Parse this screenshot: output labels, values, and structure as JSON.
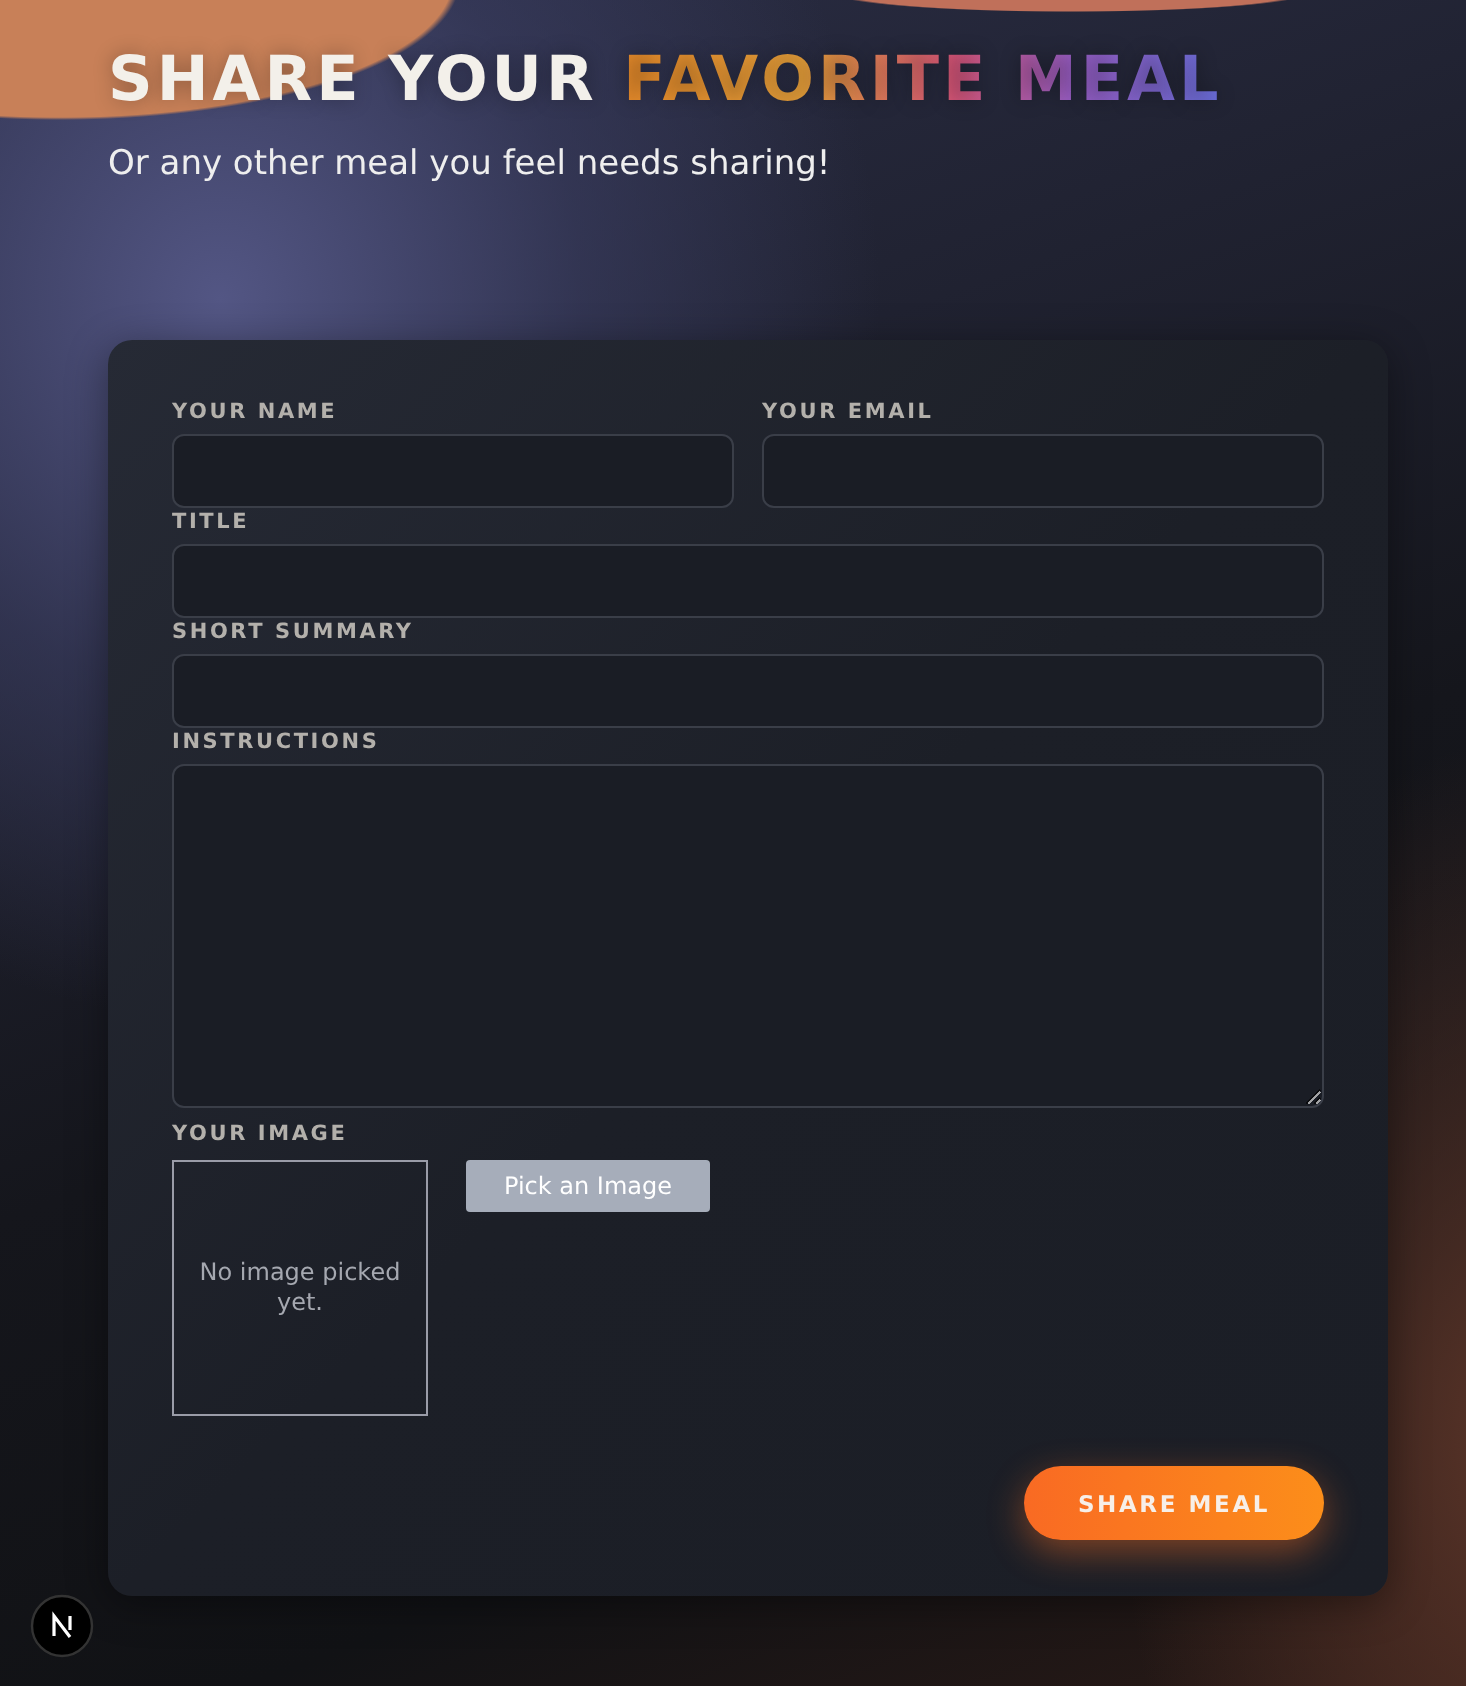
{
  "header": {
    "title": "SHARE YOUR",
    "title_highlight": "FAVORITE MEAL",
    "subtitle": "Or any other meal you feel needs sharing!"
  },
  "form": {
    "rows": [
      [
        {
          "label": "YOUR NAME",
          "kind": "input"
        },
        {
          "label": "YOUR EMAIL",
          "kind": "input"
        }
      ],
      [
        {
          "label": "TITLE",
          "kind": "input"
        }
      ],
      [
        {
          "label": "SHORT SUMMARY",
          "kind": "input"
        }
      ],
      [
        {
          "label": "INSTRUCTIONS",
          "kind": "textarea"
        }
      ]
    ],
    "image_picker": {
      "label": "YOUR IMAGE",
      "preview_text": "No image picked yet.",
      "button": "Pick an Image"
    },
    "submit": "SHARE MEAL"
  }
}
